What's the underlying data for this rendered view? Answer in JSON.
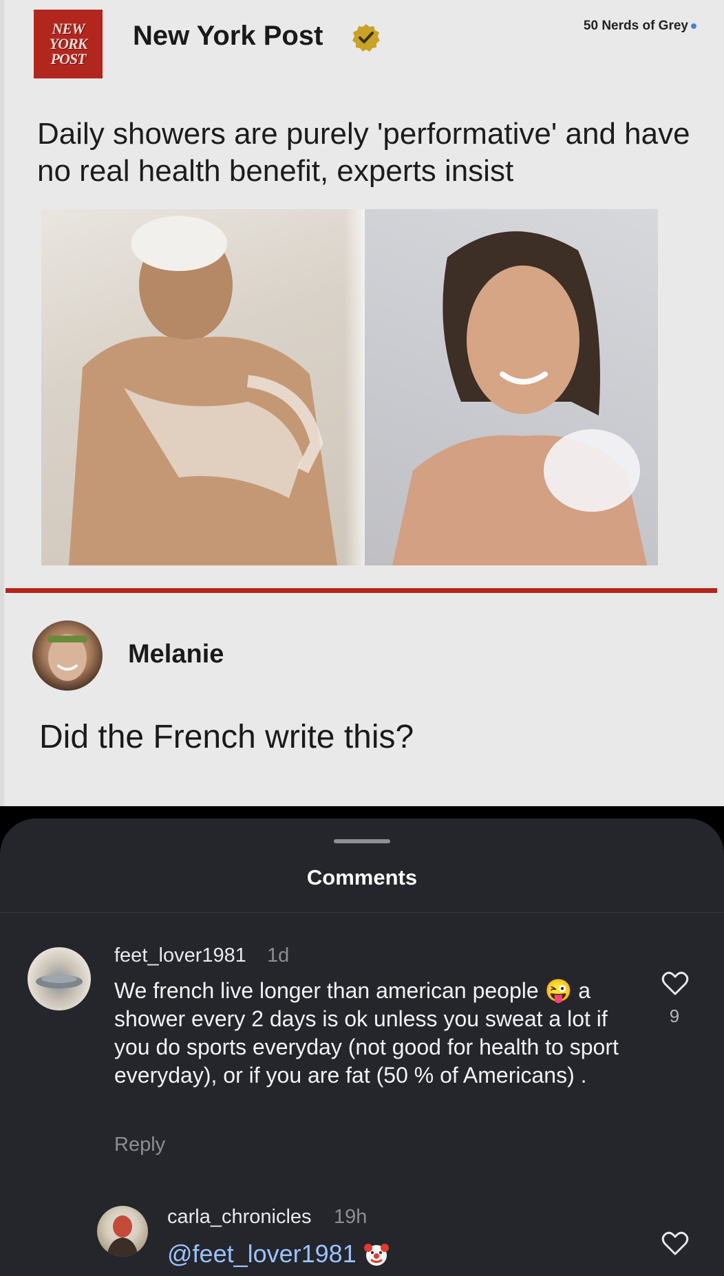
{
  "post": {
    "publisher": "New York Post",
    "logo_lines": [
      "NEW",
      "YORK",
      "POST"
    ],
    "watermark": "50 Nerds of Grey",
    "headline": "Daily showers are purely 'performative' and have no real health benefit, experts insist",
    "reposter_name": "Melanie",
    "reposter_text": "Did the French write this?"
  },
  "comments_sheet": {
    "title": "Comments",
    "comments": [
      {
        "username": "feet_lover1981",
        "time": "1d",
        "text": "We french live longer than american people 😜 a shower every 2 days is ok unless you sweat a lot if you do sports everyday (not good for health to sport everyday), or if you are fat (50 % of Americans) .",
        "reply_label": "Reply",
        "likes": "9"
      },
      {
        "username": "carla_chronicles",
        "time": "19h",
        "text": "@feet_lover1981"
      }
    ]
  },
  "icons": {
    "verified": "verified-badge-icon",
    "heart": "heart-icon",
    "clown": "clown-emoji-icon"
  },
  "colors": {
    "brand_red": "#b3261e",
    "sheet_bg": "#24262b",
    "mention": "#9cc2ff",
    "badge_gold": "#c9a227"
  }
}
